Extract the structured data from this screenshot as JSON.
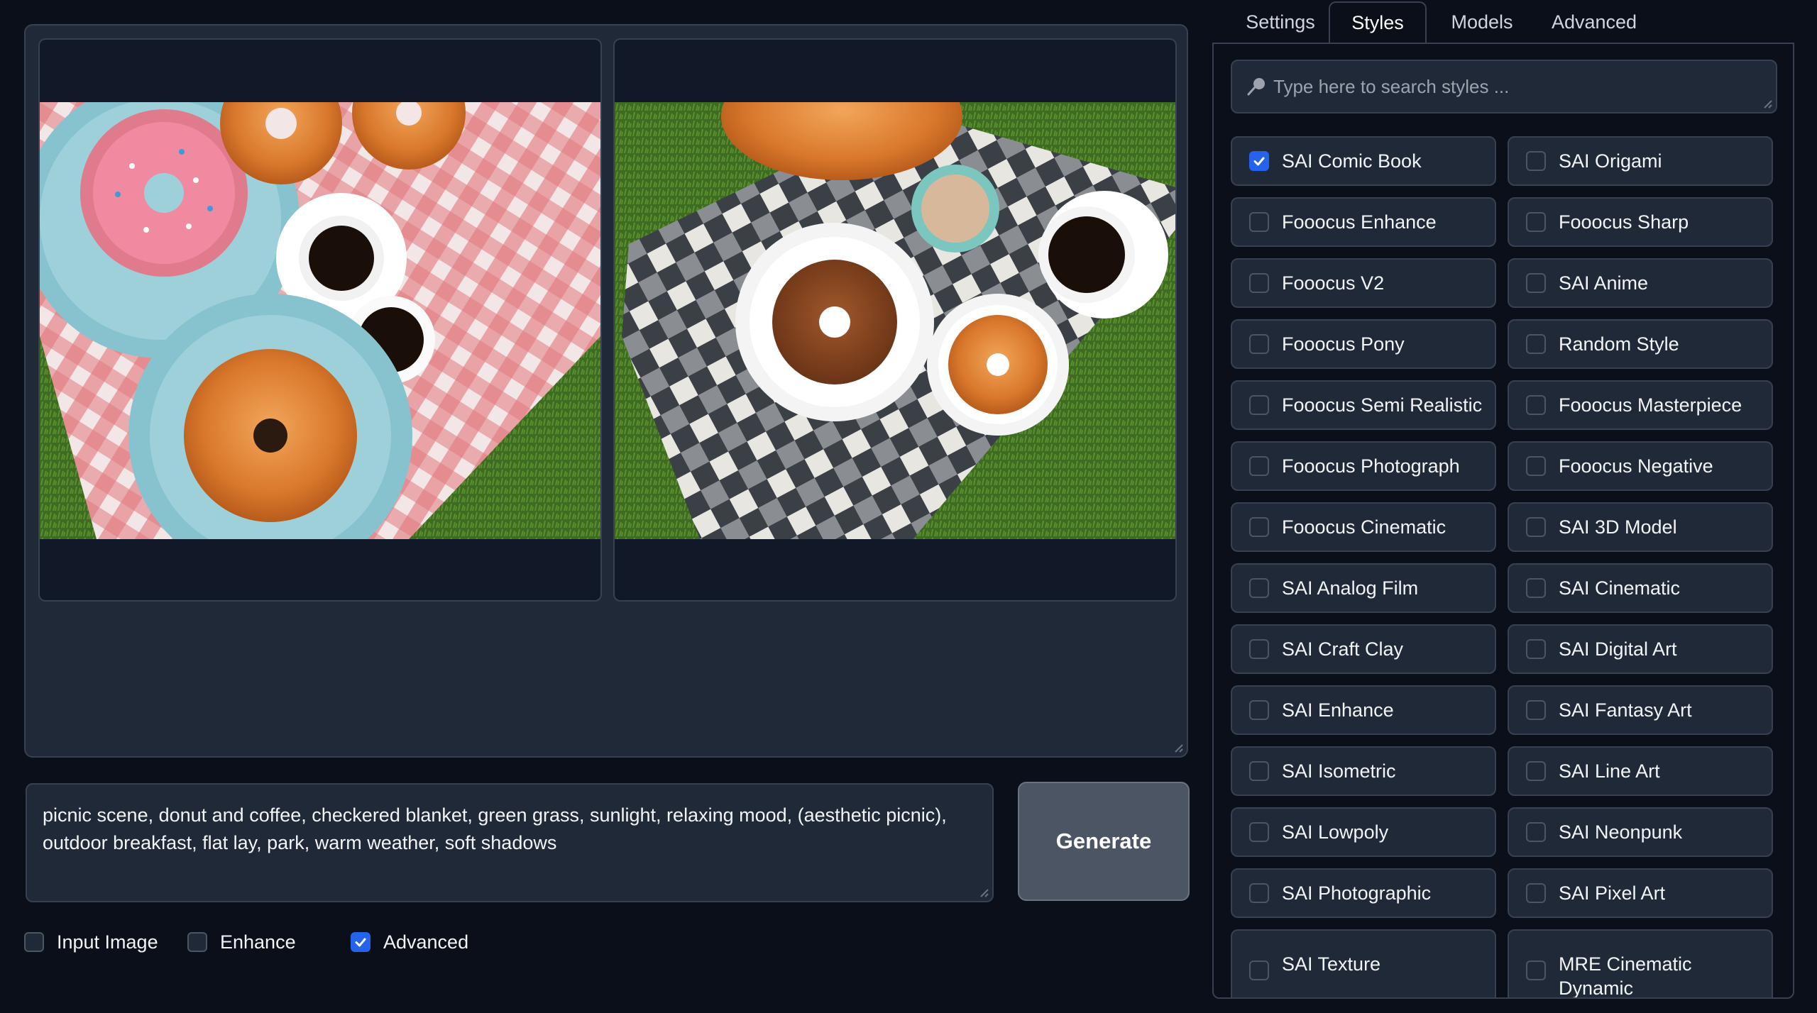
{
  "prompt": {
    "value": "picnic scene, donut and coffee, checkered blanket, green grass, sunlight, relaxing mood, (aesthetic picnic), outdoor breakfast, flat lay, park, warm weather, soft shadows"
  },
  "generate_label": "Generate",
  "options": [
    {
      "label": "Input Image",
      "checked": false
    },
    {
      "label": "Enhance",
      "checked": false
    },
    {
      "label": "Advanced",
      "checked": true
    }
  ],
  "tabs": [
    {
      "label": "Settings",
      "active": false
    },
    {
      "label": "Styles",
      "active": true
    },
    {
      "label": "Models",
      "active": false
    },
    {
      "label": "Advanced",
      "active": false
    }
  ],
  "search": {
    "placeholder": "Type here to search styles ..."
  },
  "styles": [
    {
      "label": "SAI Comic Book",
      "checked": true
    },
    {
      "label": "SAI Origami",
      "checked": false
    },
    {
      "label": "Fooocus Enhance",
      "checked": false
    },
    {
      "label": "Fooocus Sharp",
      "checked": false
    },
    {
      "label": "Fooocus V2",
      "checked": false
    },
    {
      "label": "SAI Anime",
      "checked": false
    },
    {
      "label": "Fooocus Pony",
      "checked": false
    },
    {
      "label": "Random Style",
      "checked": false
    },
    {
      "label": "Fooocus Semi Realistic",
      "checked": false
    },
    {
      "label": "Fooocus Masterpiece",
      "checked": false
    },
    {
      "label": "Fooocus Photograph",
      "checked": false
    },
    {
      "label": "Fooocus Negative",
      "checked": false
    },
    {
      "label": "Fooocus Cinematic",
      "checked": false
    },
    {
      "label": "SAI 3D Model",
      "checked": false
    },
    {
      "label": "SAI Analog Film",
      "checked": false
    },
    {
      "label": "SAI Cinematic",
      "checked": false
    },
    {
      "label": "SAI Craft Clay",
      "checked": false
    },
    {
      "label": "SAI Digital Art",
      "checked": false
    },
    {
      "label": "SAI Enhance",
      "checked": false
    },
    {
      "label": "SAI Fantasy Art",
      "checked": false
    },
    {
      "label": "SAI Isometric",
      "checked": false
    },
    {
      "label": "SAI Line Art",
      "checked": false
    },
    {
      "label": "SAI Lowpoly",
      "checked": false
    },
    {
      "label": "SAI Neonpunk",
      "checked": false
    },
    {
      "label": "SAI Photographic",
      "checked": false
    },
    {
      "label": "SAI Pixel Art",
      "checked": false
    },
    {
      "label": "SAI Texture",
      "checked": false
    },
    {
      "label": "MRE Cinematic Dynamic",
      "checked": false
    }
  ],
  "colors": {
    "accent": "#2563eb",
    "background": "#0b0f19",
    "panel": "#1f2937",
    "border": "#374151"
  }
}
